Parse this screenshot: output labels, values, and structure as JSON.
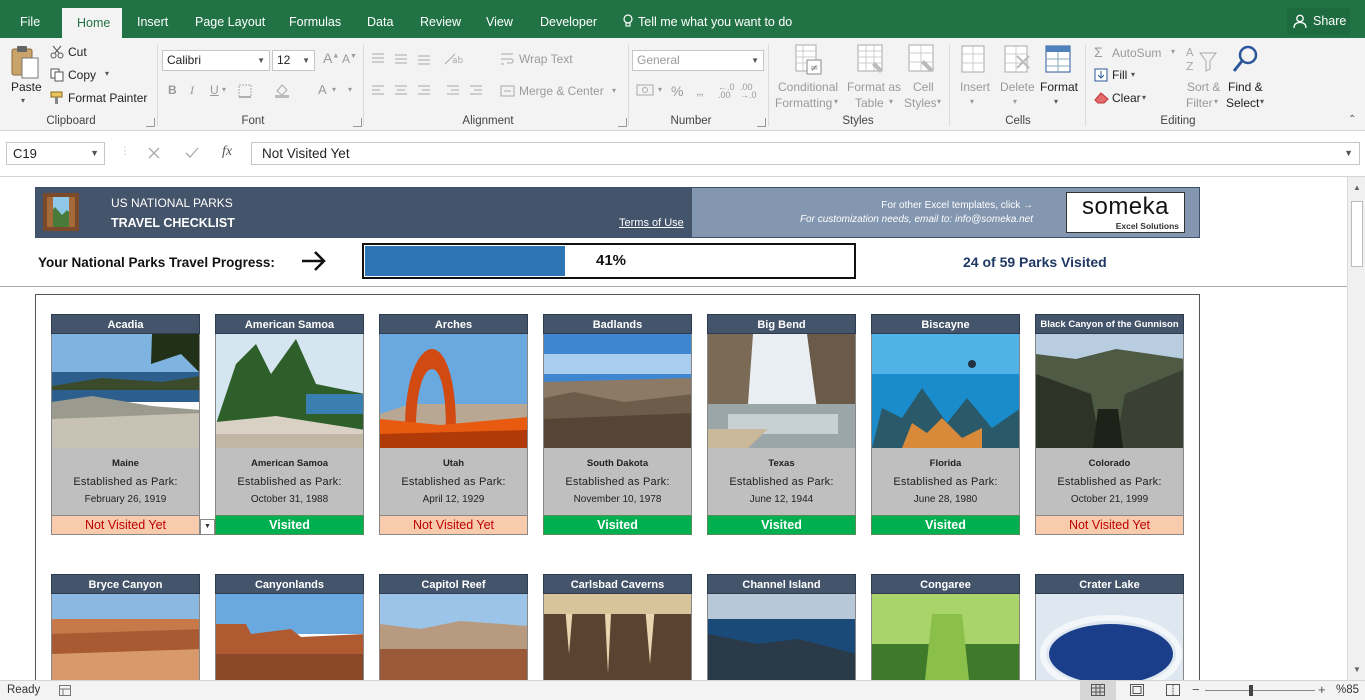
{
  "tabs": [
    {
      "label": "File",
      "active": false
    },
    {
      "label": "Home",
      "active": true
    },
    {
      "label": "Insert",
      "active": false
    },
    {
      "label": "Page Layout",
      "active": false
    },
    {
      "label": "Formulas",
      "active": false
    },
    {
      "label": "Data",
      "active": false
    },
    {
      "label": "Review",
      "active": false
    },
    {
      "label": "View",
      "active": false
    },
    {
      "label": "Developer",
      "active": false
    }
  ],
  "tell_me": "Tell me what you want to do",
  "share": "Share",
  "ribbon": {
    "clipboard": {
      "paste": "Paste",
      "cut": "Cut",
      "copy": "Copy",
      "format_painter": "Format Painter",
      "label": "Clipboard"
    },
    "font": {
      "name": "Calibri",
      "size": "12",
      "bold": "B",
      "italic": "I",
      "underline": "U",
      "label": "Font"
    },
    "alignment": {
      "wrap": "Wrap Text",
      "merge": "Merge & Center",
      "label": "Alignment"
    },
    "number": {
      "format": "General",
      "percent": "%",
      "label": "Number"
    },
    "styles": {
      "conditional_1": "Conditional",
      "conditional_2": "Formatting",
      "table_1": "Format as",
      "table_2": "Table",
      "cell_1": "Cell",
      "cell_2": "Styles",
      "label": "Styles"
    },
    "cells": {
      "insert": "Insert",
      "delete": "Delete",
      "format": "Format",
      "label": "Cells"
    },
    "editing": {
      "autosum": "AutoSum",
      "fill": "Fill",
      "clear": "Clear",
      "sort_1": "Sort &",
      "sort_2": "Filter",
      "find_1": "Find &",
      "find_2": "Select",
      "label": "Editing"
    }
  },
  "formula_bar": {
    "name_box": "C19",
    "formula": "Not Visited Yet"
  },
  "header": {
    "line1": "US NATIONAL PARKS",
    "line2": "TRAVEL CHECKLIST",
    "terms": "Terms of Use",
    "other": "For other Excel templates, click →",
    "custom": "For customization needs, email to: info@someka.net",
    "logo": "someka",
    "logo_sub": "Excel Solutions"
  },
  "progress": {
    "label": "Your National Parks Travel Progress:",
    "percent_text": "41%",
    "fraction": 0.41,
    "count_text": "24 of 59 Parks Visited"
  },
  "parks_row1": [
    {
      "name": "Acadia",
      "state": "Maine",
      "est": "Established as Park:",
      "date": "February 26, 1919",
      "status": "Not Visited Yet"
    },
    {
      "name": "American Samoa",
      "state": "American Samoa",
      "est": "Established as Park:",
      "date": "October 31, 1988",
      "status": "Visited"
    },
    {
      "name": "Arches",
      "state": "Utah",
      "est": "Established as Park:",
      "date": "April 12, 1929",
      "status": "Not Visited Yet"
    },
    {
      "name": "Badlands",
      "state": "South Dakota",
      "est": "Established as Park:",
      "date": "November 10, 1978",
      "status": "Visited"
    },
    {
      "name": "Big Bend",
      "state": "Texas",
      "est": "Established as Park:",
      "date": "June 12, 1944",
      "status": "Visited"
    },
    {
      "name": "Biscayne",
      "state": "Florida",
      "est": "Established as Park:",
      "date": "June 28, 1980",
      "status": "Visited"
    },
    {
      "name": "Black Canyon of the Gunnison",
      "state": "Colorado",
      "est": "Established as Park:",
      "date": "October 21, 1999",
      "status": "Not Visited Yet"
    }
  ],
  "parks_row2": [
    {
      "name": "Bryce Canyon"
    },
    {
      "name": "Canyonlands"
    },
    {
      "name": "Capitol Reef"
    },
    {
      "name": "Carlsbad Caverns"
    },
    {
      "name": "Channel Island"
    },
    {
      "name": "Congaree"
    },
    {
      "name": "Crater Lake"
    }
  ],
  "status_bar": {
    "ready": "Ready",
    "zoom": "%85"
  },
  "colors": {
    "excel_green": "#217346",
    "header_dark": "#44546a",
    "header_light": "#8497b0",
    "visited": "#00b050",
    "not_visited": "#f8cbad",
    "progress": "#2e75b6"
  }
}
